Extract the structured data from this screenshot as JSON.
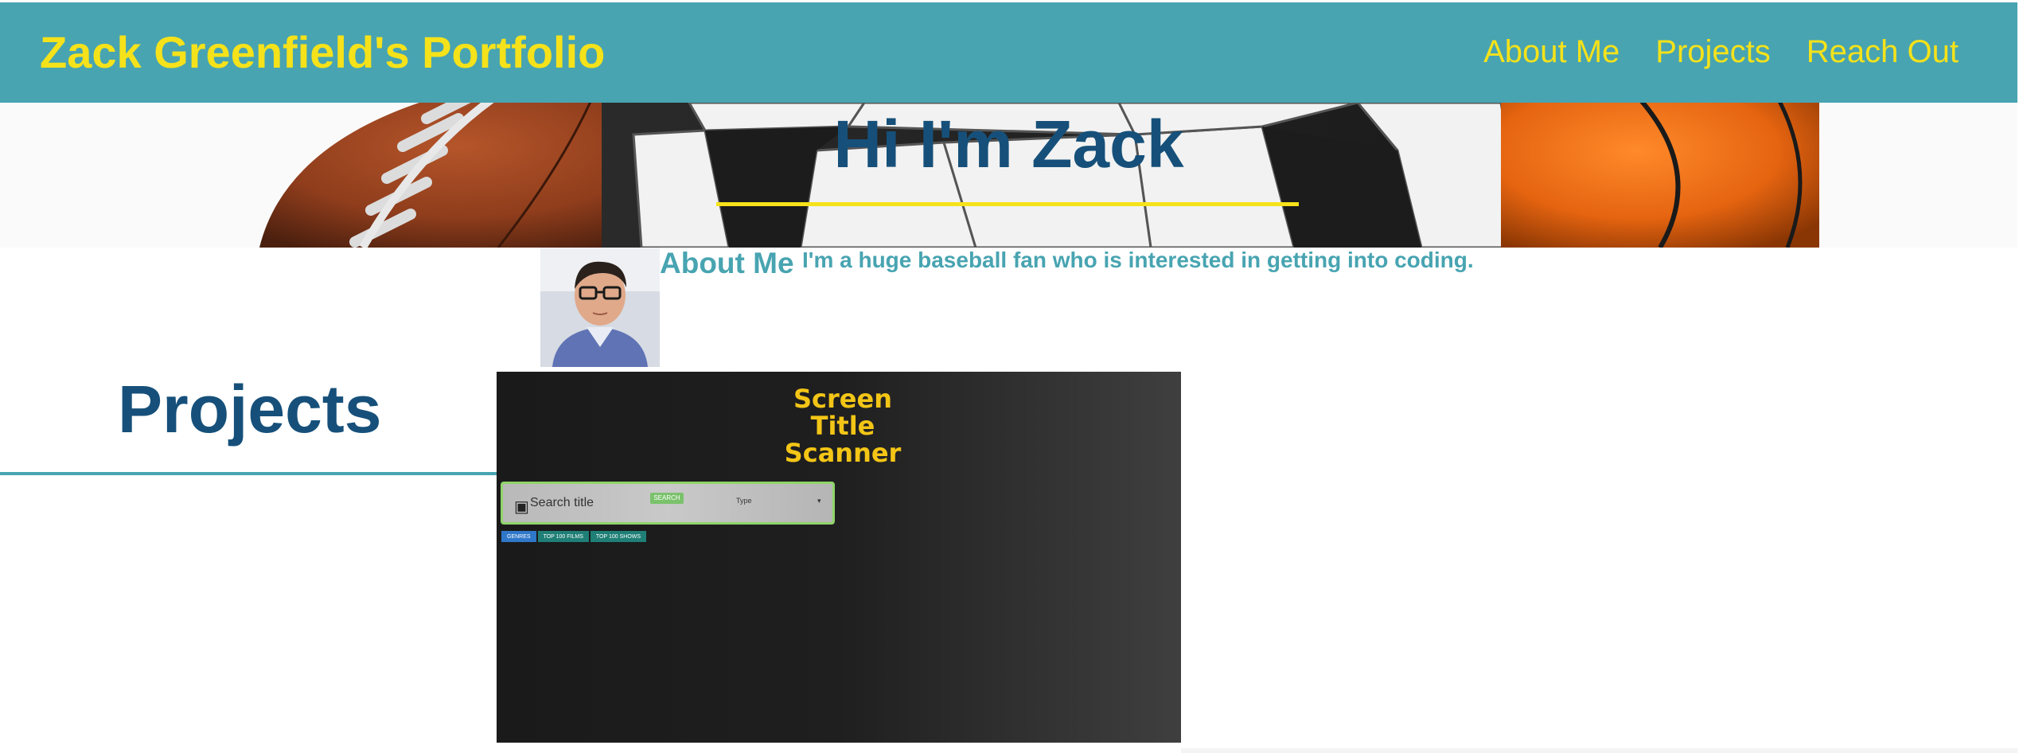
{
  "header": {
    "title": "Zack Greenfield's Portfolio",
    "nav": [
      "About Me",
      "Projects",
      "Reach Out"
    ]
  },
  "hero": {
    "title": "Hi I'm Zack"
  },
  "about": {
    "heading": "About Me",
    "text": "I'm a huge baseball fan who is interested in getting into coding."
  },
  "projects": {
    "heading": "Projects",
    "screenshot": {
      "logo_line1": "Screen",
      "logo_line2": "Title",
      "logo_line3": "Scanner",
      "search_placeholder": "Search title",
      "search_button": "SEARCH",
      "type_label": "Type",
      "chips": [
        "GENRES",
        "TOP 100 FILMS",
        "TOP 100 SHOWS"
      ]
    }
  },
  "colors": {
    "header_bg": "#48a4b1",
    "accent_yellow": "#f5e21a",
    "heading_blue": "#16507a",
    "teal_text": "#48a4b1"
  }
}
